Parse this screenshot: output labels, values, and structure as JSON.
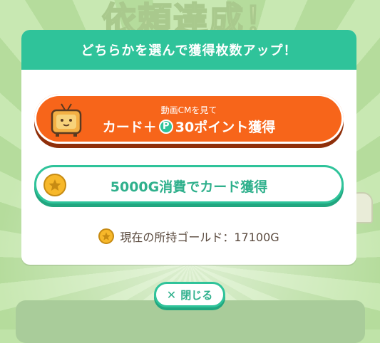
{
  "background": {
    "title": "依頼達成！"
  },
  "dialog": {
    "header": "どちらかを選んで獲得枚数アップ！",
    "cm_button": {
      "subtext": "動画CMを見て",
      "text_before": "カード＋",
      "point_badge": "P",
      "text_after": "30ポイント獲得",
      "icon": "tv-character-icon"
    },
    "gold_button": {
      "label": "5000G消費でカード獲得",
      "icon": "gold-coin-icon"
    },
    "gold_status": "現在の所持ゴールド：17100G"
  },
  "close_button": {
    "label": "閉じる",
    "icon": "close-icon"
  },
  "colors": {
    "header_green": "#2fc39a",
    "cm_orange": "#f7651a",
    "text_green": "#2fb08c",
    "coin_gold": "#f7b82a"
  }
}
